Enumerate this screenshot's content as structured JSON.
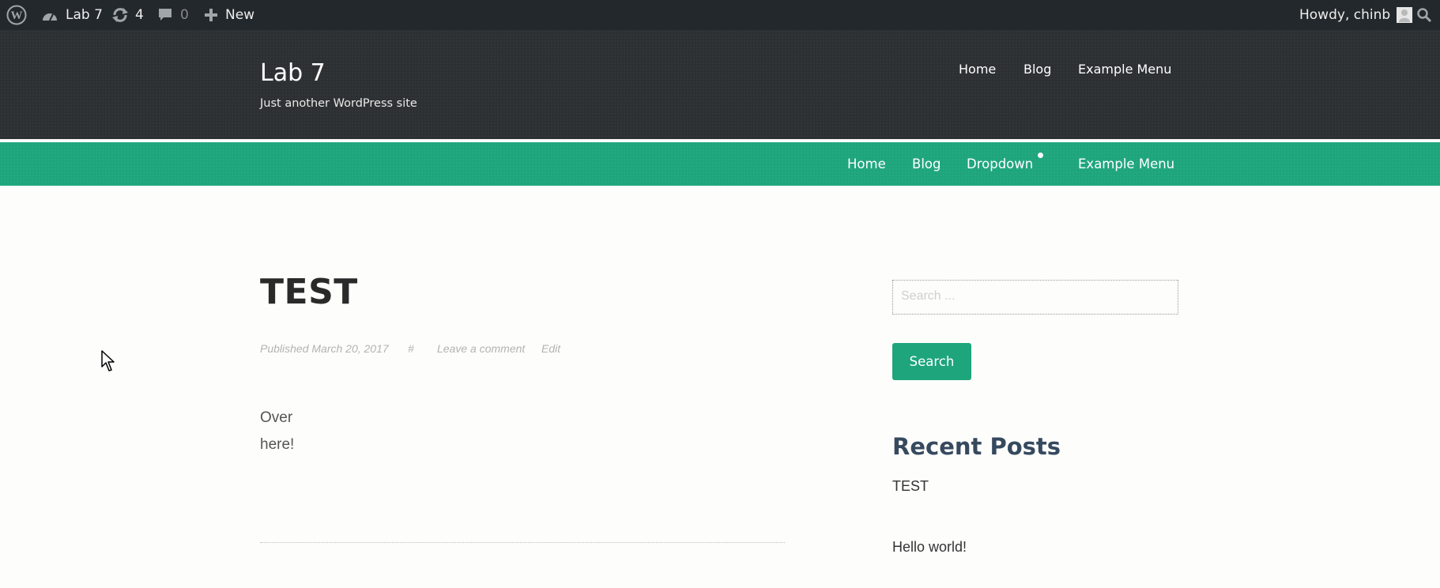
{
  "admin_bar": {
    "wp_logo_icon": "wordpress-logo-icon",
    "site_name": "Lab 7",
    "updates_count": "4",
    "comments_count": "0",
    "new_label": "New",
    "greeting": "Howdy, chinb",
    "search_icon": "search-icon"
  },
  "header": {
    "site_title": "Lab 7",
    "tagline": "Just another WordPress site",
    "top_menu": [
      "Home",
      "Blog",
      "Example Menu"
    ]
  },
  "primary_menu": {
    "items": [
      "Home",
      "Blog",
      "Dropdown",
      "Example Menu"
    ]
  },
  "post": {
    "title": "TEST",
    "meta": {
      "published": "Published March 20, 2017",
      "permalink": "#",
      "comment": "Leave a comment",
      "edit": "Edit"
    },
    "content": [
      "Over",
      "here!"
    ]
  },
  "sidebar": {
    "search_placeholder": "Search ...",
    "search_button": "Search",
    "recent_posts_title": "Recent Posts",
    "recent_posts": [
      "TEST",
      "Hello world!"
    ]
  },
  "colors": {
    "accent": "#1ea57c",
    "admin_bar": "#23282d",
    "masthead": "#2d3032",
    "widget_title": "#36495e"
  }
}
